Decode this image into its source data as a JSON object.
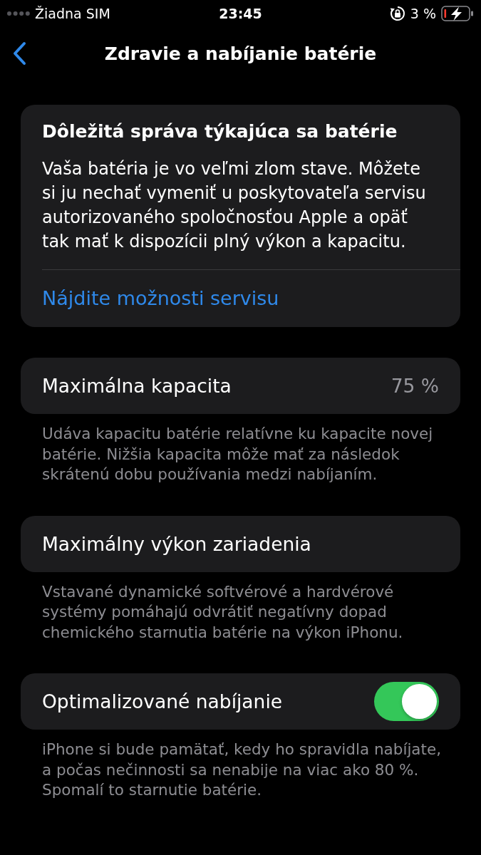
{
  "status_bar": {
    "carrier": "Žiadna SIM",
    "time": "23:45",
    "battery_percent": "3 %"
  },
  "nav": {
    "title": "Zdravie a nabíjanie batérie"
  },
  "alert_card": {
    "title": "Dôležitá správa týkajúca sa batérie",
    "body": "Vaša batéria je vo veľmi zlom stave. Môžete si ju nechať vymeniť u poskytovateľa servisu autorizovaného spoločnosťou Apple a opäť tak mať k dispozícii plný výkon a kapacitu.",
    "link": "Nájdite možnosti servisu"
  },
  "sections": [
    {
      "kind": "value",
      "label": "Maximálna kapacita",
      "value": "75 %",
      "footer": "Udáva kapacitu batérie relatívne ku kapacite novej batérie. Nižšia kapacita môže mať za následok skrátenú dobu používania medzi nabíjaním."
    },
    {
      "kind": "plain",
      "label": "Maximálny výkon zariadenia",
      "footer": "Vstavané dynamické softvérové a hardvérové systémy pomáhajú odvrátiť negatívny dopad chemického starnutia batérie na výkon iPhonu."
    },
    {
      "kind": "toggle",
      "label": "Optimalizované nabíjanie",
      "on": true,
      "footer": "iPhone si bude pamätať, kedy ho spravidla nabíjate, a počas nečinnosti sa nenabije na viac ako 80 %. Spomalí to starnutie batérie."
    }
  ]
}
